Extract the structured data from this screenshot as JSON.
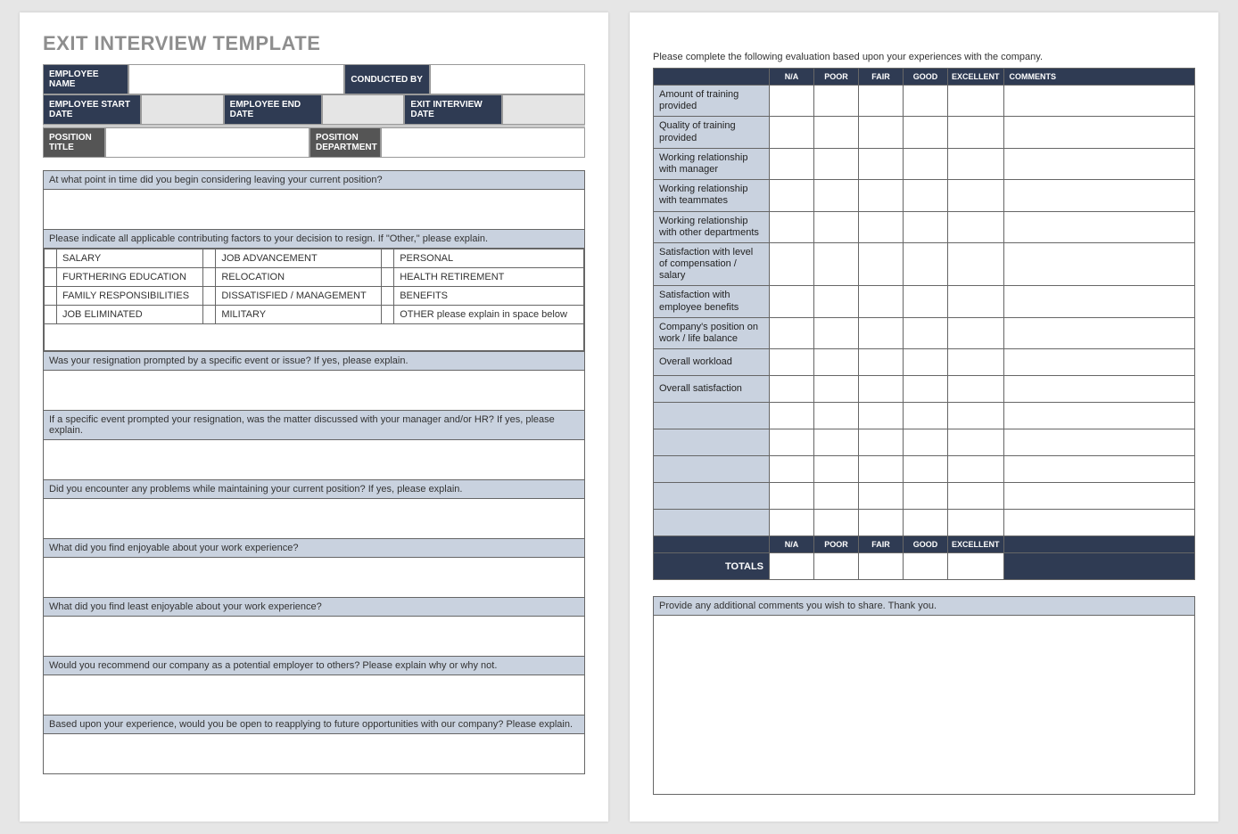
{
  "title": "EXIT INTERVIEW TEMPLATE",
  "header": {
    "employee_name_label": "EMPLOYEE NAME",
    "conducted_by_label": "CONDUCTED BY",
    "employee_start_date_label": "EMPLOYEE START DATE",
    "employee_end_date_label": "EMPLOYEE END DATE",
    "exit_interview_date_label": "EXIT INTERVIEW DATE",
    "position_title_label": "POSITION TITLE",
    "position_department_label": "POSITION DEPARTMENT"
  },
  "questions": {
    "q1": "At what point in time did you begin considering leaving your current position?",
    "factors_label": "Please indicate all applicable contributing factors to your decision to resign. If \"Other,\" please explain.",
    "factors": {
      "r1c1": "SALARY",
      "r1c2": "JOB ADVANCEMENT",
      "r1c3": "PERSONAL",
      "r2c1": "FURTHERING EDUCATION",
      "r2c2": "RELOCATION",
      "r2c3": "HEALTH RETIREMENT",
      "r3c1": "FAMILY RESPONSIBILITIES",
      "r3c2": "DISSATISFIED / MANAGEMENT",
      "r3c3": "BENEFITS",
      "r4c1": "JOB ELIMINATED",
      "r4c2": "MILITARY",
      "r4c3": "OTHER please explain in space below"
    },
    "q2": "Was your resignation prompted by a specific event or issue? If yes, please explain.",
    "q3": "If a specific event prompted your resignation, was the matter discussed with your manager and/or HR? If yes, please explain.",
    "q4": "Did you encounter any problems while maintaining your current position?  If yes, please explain.",
    "q5": "What did you find enjoyable about your work experience?",
    "q6": "What did you find least enjoyable about your work experience?",
    "q7": "Would you recommend our company as a potential employer to others? Please explain why or why not.",
    "q8": "Based upon your experience, would you be open to reapplying to future opportunities with our company?  Please explain."
  },
  "page2": {
    "instruction": "Please complete the following evaluation based upon your experiences with the company.",
    "columns": {
      "na": "N/A",
      "poor": "POOR",
      "fair": "FAIR",
      "good": "GOOD",
      "excellent": "EXCELLENT",
      "comments": "COMMENTS"
    },
    "rows": [
      "Amount of training provided",
      "Quality of training provided",
      "Working relationship with manager",
      "Working relationship with teammates",
      "Working relationship with other departments",
      "Satisfaction with level of compensation / salary",
      "Satisfaction with employee benefits",
      "Company's position on work / life balance",
      "Overall workload",
      "Overall satisfaction"
    ],
    "totals_label": "TOTALS",
    "additional_comments_label": "Provide any additional comments you wish to share.  Thank you."
  }
}
